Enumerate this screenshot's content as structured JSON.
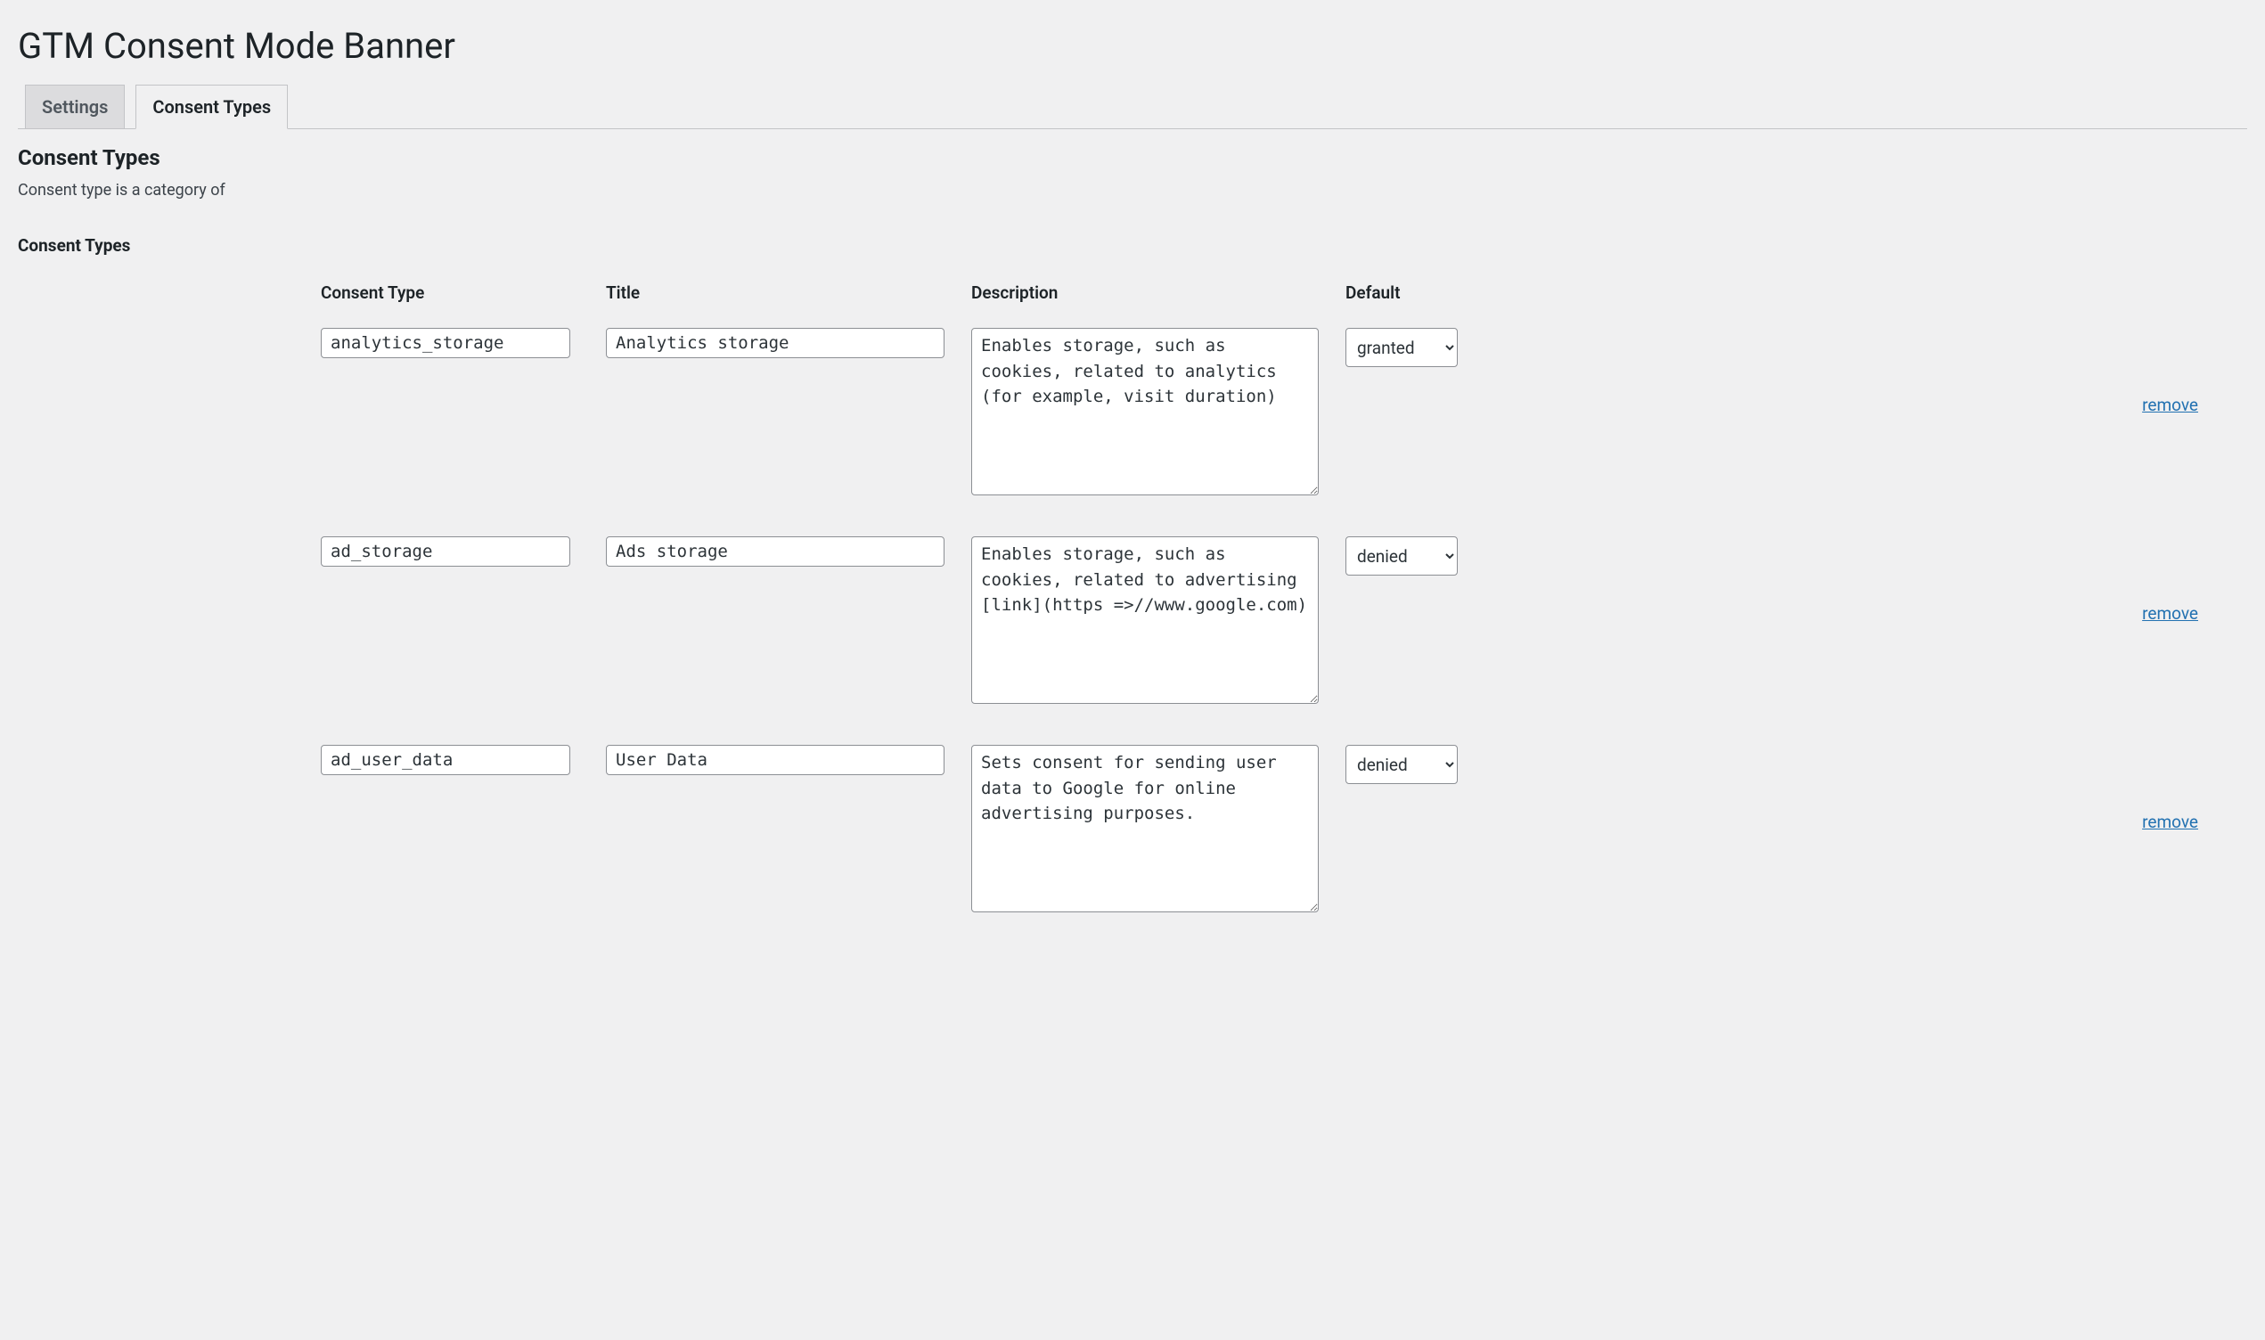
{
  "page": {
    "title": "GTM Consent Mode Banner"
  },
  "tabs": [
    {
      "label": "Settings",
      "active": false
    },
    {
      "label": "Consent Types",
      "active": true
    }
  ],
  "section": {
    "heading": "Consent Types",
    "description": "Consent type is a category of",
    "tableHeading": "Consent Types"
  },
  "columns": {
    "type": "Consent Type",
    "title": "Title",
    "description": "Description",
    "default": "Default"
  },
  "defaultOptions": [
    "granted",
    "denied"
  ],
  "removeLabel": "remove",
  "rows": [
    {
      "type": "analytics_storage",
      "title": "Analytics storage",
      "description": "Enables storage, such as cookies, related to analytics (for example, visit duration)",
      "default": "granted"
    },
    {
      "type": "ad_storage",
      "title": "Ads storage",
      "description": "Enables storage, such as cookies, related to advertising [link](https =>//www.google.com)",
      "default": "denied"
    },
    {
      "type": "ad_user_data",
      "title": "User Data",
      "description": "Sets consent for sending user data to Google for online advertising purposes.",
      "default": "denied"
    }
  ]
}
